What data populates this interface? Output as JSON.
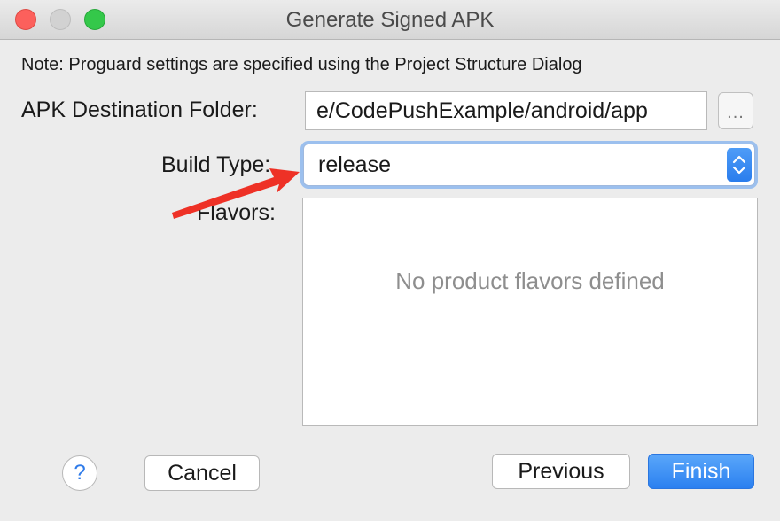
{
  "window": {
    "title": "Generate Signed APK"
  },
  "note": "Note: Proguard settings are specified using the Project Structure Dialog",
  "form": {
    "destination_label": "APK Destination Folder:",
    "destination_value": "e/CodePushExample/android/app",
    "browse_label": "...",
    "build_type_label": "Build Type:",
    "build_type_value": "release",
    "flavors_label": "Flavors:",
    "flavors_empty_text": "No product flavors defined"
  },
  "buttons": {
    "help": "?",
    "cancel": "Cancel",
    "previous": "Previous",
    "finish": "Finish"
  },
  "annotation": {
    "arrow_color": "#ee3126"
  },
  "colors": {
    "accent": "#2b80f0",
    "close": "#fc605c",
    "maximize": "#34c84a"
  }
}
